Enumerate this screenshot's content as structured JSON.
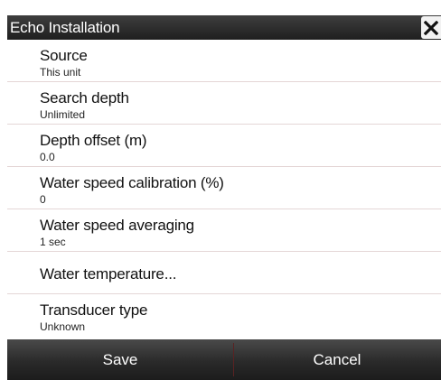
{
  "dialog": {
    "title": "Echo Installation",
    "close_icon": "close-icon"
  },
  "items": [
    {
      "label": "Source",
      "value": "This unit"
    },
    {
      "label": "Search depth",
      "value": "Unlimited"
    },
    {
      "label": "Depth offset (m)",
      "value": "0.0"
    },
    {
      "label": "Water speed calibration (%)",
      "value": "0"
    },
    {
      "label": "Water speed averaging",
      "value": "1 sec"
    },
    {
      "label": "Water temperature...",
      "value": ""
    },
    {
      "label": "Transducer type",
      "value": "Unknown"
    }
  ],
  "buttons": {
    "save_label": "Save",
    "cancel_label": "Cancel"
  }
}
